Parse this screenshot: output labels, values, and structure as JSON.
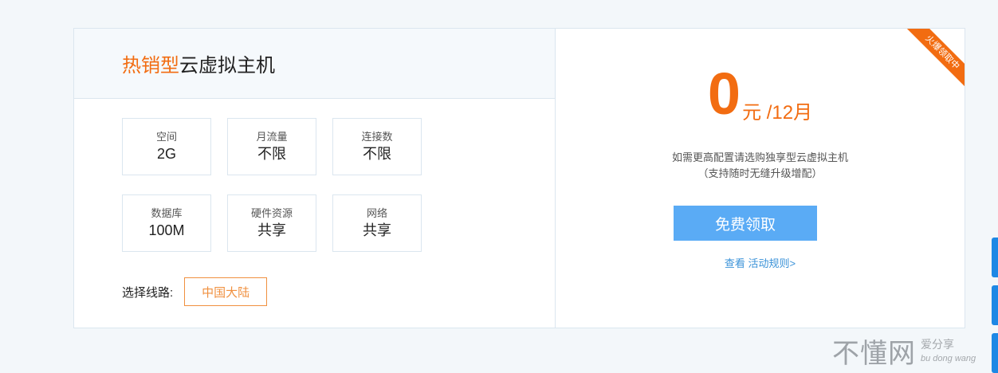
{
  "left": {
    "title_highlight": "热销型",
    "title_rest": "云虚拟主机",
    "specs": [
      {
        "label": "空间",
        "value": "2G"
      },
      {
        "label": "月流量",
        "value": "不限"
      },
      {
        "label": "连接数",
        "value": "不限"
      },
      {
        "label": "数据库",
        "value": "100M"
      },
      {
        "label": "硬件资源",
        "value": "共享"
      },
      {
        "label": "网络",
        "value": "共享"
      }
    ],
    "route_label": "选择线路:",
    "route_option": "中国大陆"
  },
  "right": {
    "ribbon": "火爆领取中",
    "price_num": "0",
    "price_unit": "元 /12月",
    "desc_line1": "如需更高配置请选购独享型云虚拟主机",
    "desc_line2": "（支持随时无缝升级增配）",
    "free_button": "免费领取",
    "rules_link": "查看 活动规则>"
  },
  "watermark": {
    "main": "不懂网",
    "sub1": "爱分享",
    "sub2": "bu dong wang"
  },
  "colors": {
    "accent": "#f26c11",
    "button": "#5aabf5",
    "link": "#3a92d8",
    "side_tab": "#1e88e5"
  }
}
